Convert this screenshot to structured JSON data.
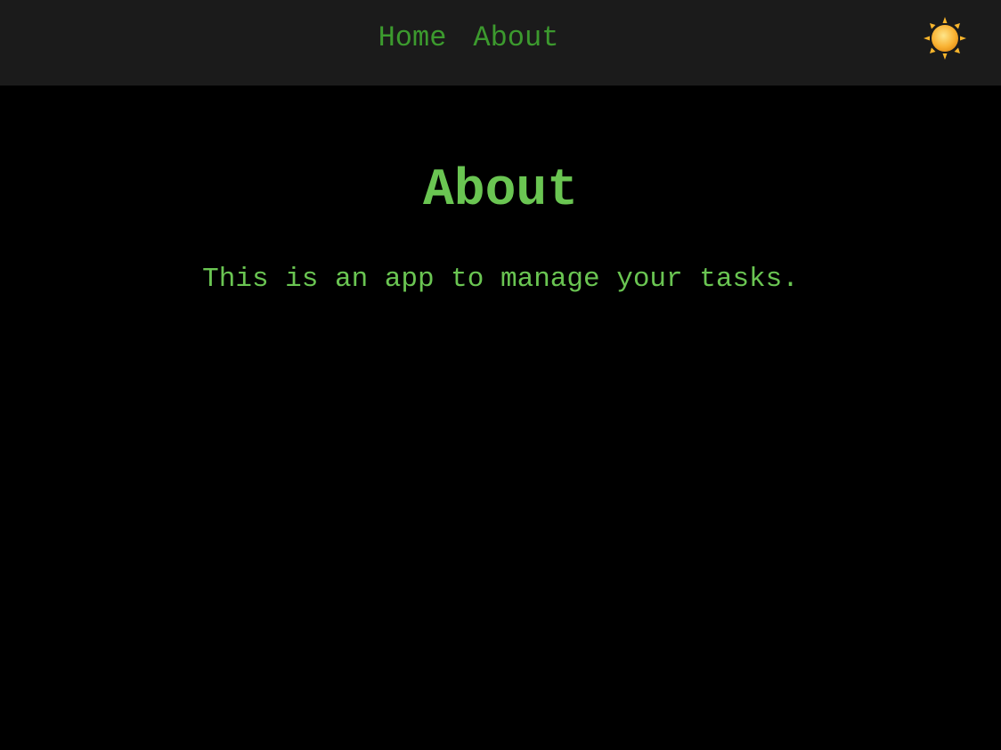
{
  "nav": {
    "links": [
      {
        "label": "Home"
      },
      {
        "label": "About"
      }
    ],
    "theme_toggle_icon": "sun-icon"
  },
  "main": {
    "title": "About",
    "body": "This is an app to manage your tasks."
  },
  "colors": {
    "background": "#000000",
    "navbar": "#1b1b1b",
    "link": "#3c9a2e",
    "text": "#6ac552",
    "sun": "#f9b233"
  }
}
